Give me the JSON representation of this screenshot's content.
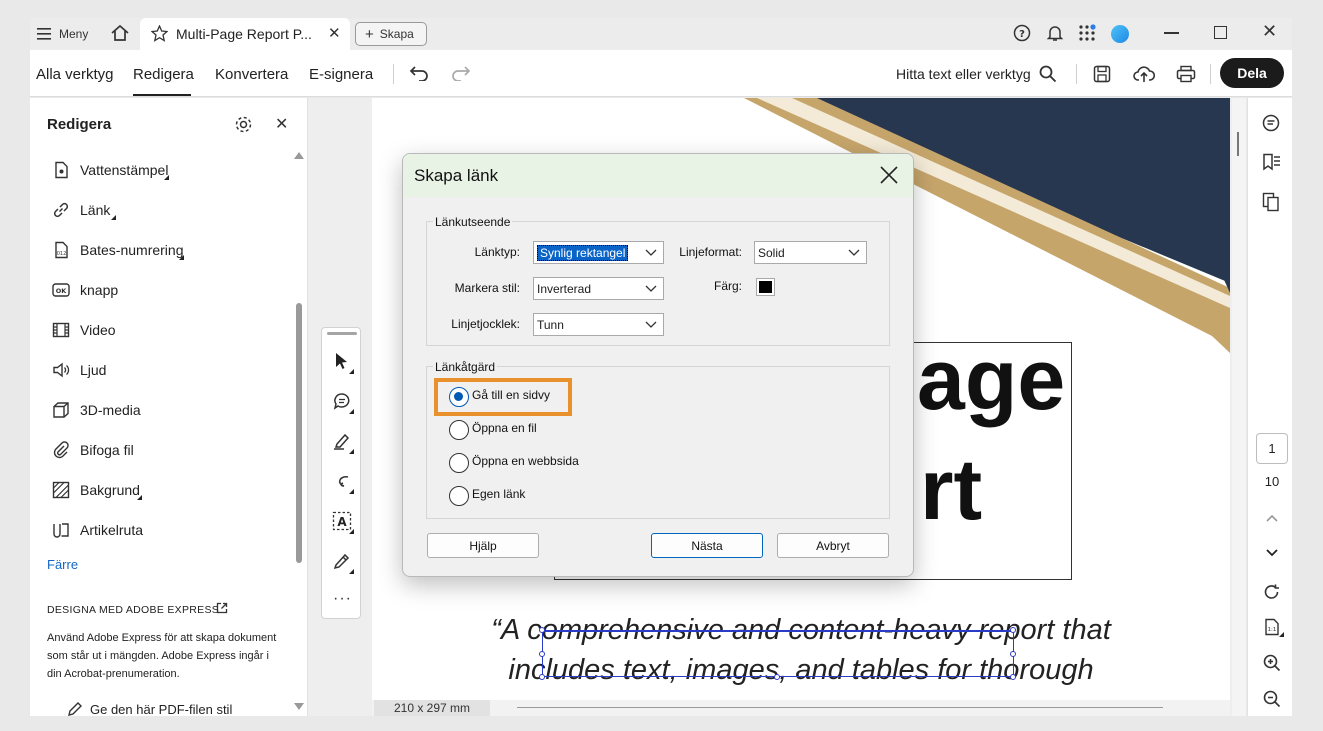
{
  "window": {
    "menu_label": "Meny",
    "tab_title": "Multi-Page Report P...",
    "new_label": "Skapa"
  },
  "toolbar": {
    "tabs": [
      "Alla verktyg",
      "Redigera",
      "Konvertera",
      "E-signera"
    ],
    "active_tab": "Redigera",
    "search_text": "Hitta text eller verktyg",
    "share_label": "Dela"
  },
  "left_panel": {
    "title": "Redigera",
    "items": [
      {
        "label": "Vattenstämpel",
        "icon": "watermark-icon"
      },
      {
        "label": "Länk",
        "icon": "link-icon"
      },
      {
        "label": "Bates-numrering",
        "icon": "bates-icon"
      },
      {
        "label": "knapp",
        "icon": "ok-button-icon"
      },
      {
        "label": "Video",
        "icon": "video-icon"
      },
      {
        "label": "Ljud",
        "icon": "audio-icon"
      },
      {
        "label": "3D-media",
        "icon": "cube-icon"
      },
      {
        "label": "Bifoga fil",
        "icon": "paperclip-icon"
      },
      {
        "label": "Bakgrund",
        "icon": "background-icon"
      },
      {
        "label": "Artikelruta",
        "icon": "article-icon"
      }
    ],
    "fewer_link": "Färre",
    "promo_heading": "DESIGNA MED ADOBE EXPRESS",
    "promo_text": "Använd Adobe Express för att skapa dokument som står ut i mängden. Adobe Express ingår i din Acrobat-prenumeration.",
    "promo_action": "Ge den här PDF-filen stil"
  },
  "document": {
    "heading_line1": "age",
    "heading_line2": "rt",
    "quote_line1": "“A comprehensive and content-heavy report that",
    "quote_line2": "includes text, images, and tables for thorough",
    "page_size": "210 x 297 mm"
  },
  "page_nav": {
    "current_page": "1",
    "total_pages": "10"
  },
  "dialog": {
    "title": "Skapa länk",
    "appearance_legend": "Länkutseende",
    "link_type_label": "Länktyp:",
    "link_type_value": "Synlig rektangel",
    "line_style_label": "Linjeformat:",
    "line_style_value": "Solid",
    "highlight_label": "Markera stil:",
    "highlight_value": "Inverterad",
    "color_label": "Färg:",
    "color_value": "#000000",
    "thickness_label": "Linjetjocklek:",
    "thickness_value": "Tunn",
    "action_legend": "Länkåtgärd",
    "options": [
      "Gå till en sidvy",
      "Öppna en fil",
      "Öppna en webbsida",
      "Egen länk"
    ],
    "selected_option": "Gå till en sidvy",
    "help_button": "Hjälp",
    "next_button": "Nästa",
    "cancel_button": "Avbryt"
  },
  "colors": {
    "highlight_box": "#e8912d",
    "accent_blue": "#0059b3",
    "banner_navy": "#283750",
    "banner_gold": "#c4a36a",
    "share_button": "#1b1b1b"
  }
}
